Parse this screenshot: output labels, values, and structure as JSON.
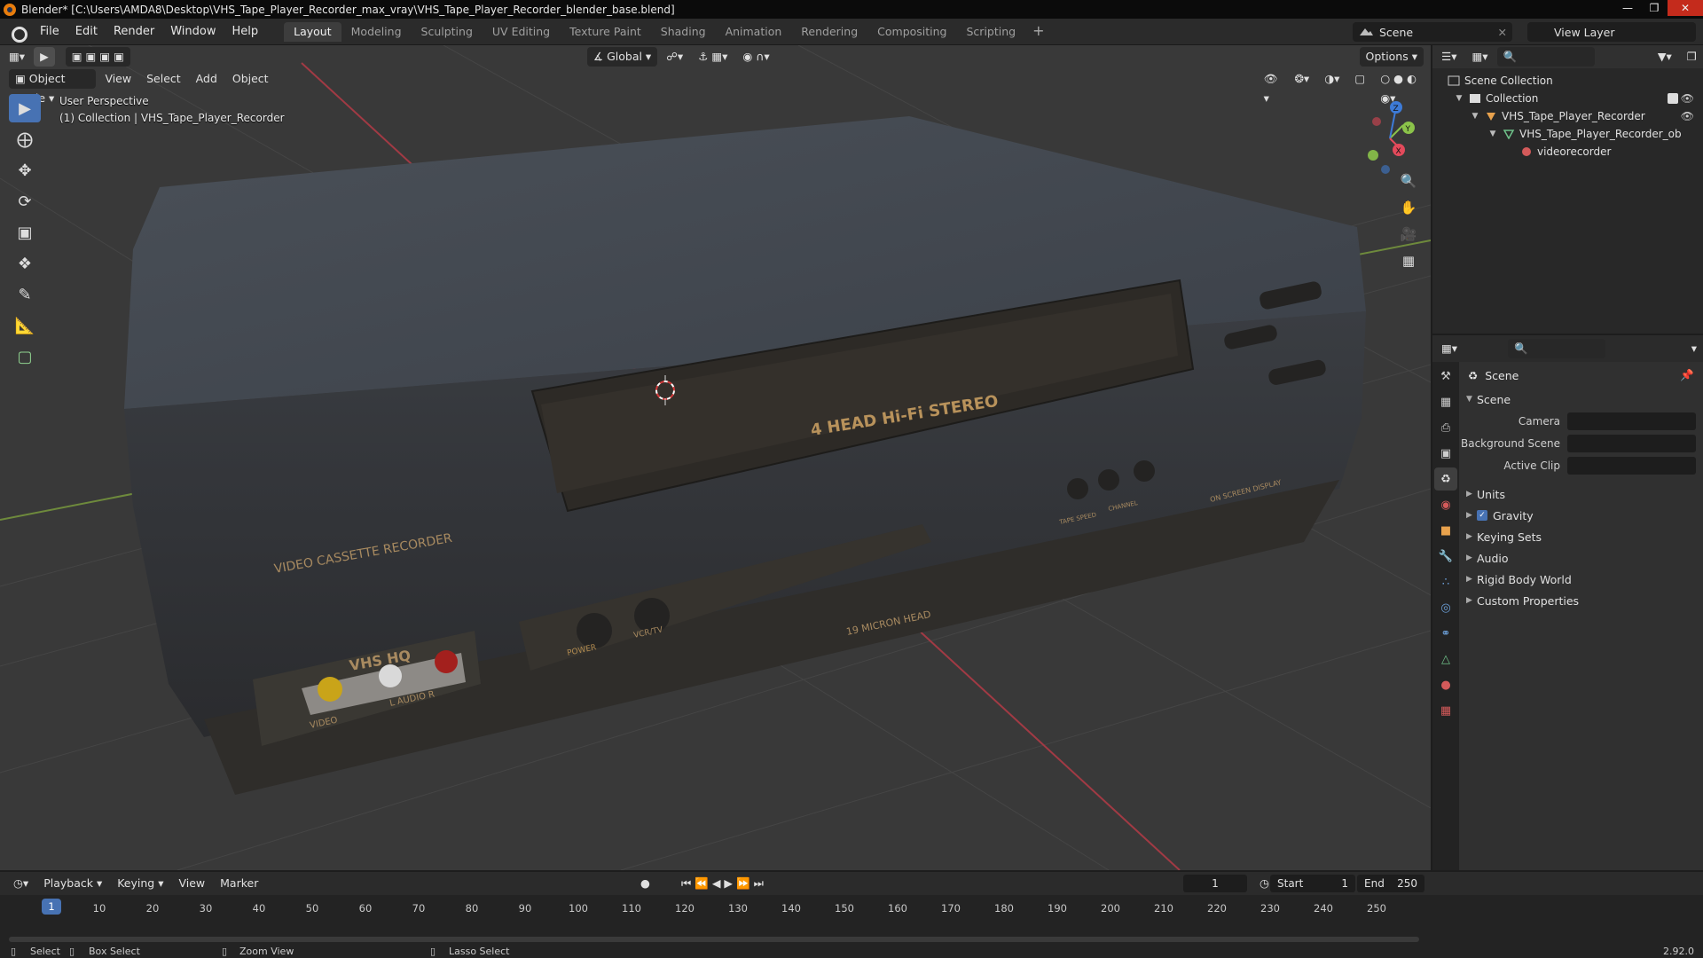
{
  "window": {
    "title": "Blender* [C:\\Users\\AMDA8\\Desktop\\VHS_Tape_Player_Recorder_max_vray\\VHS_Tape_Player_Recorder_blender_base.blend]"
  },
  "topbar": {
    "menus": [
      "File",
      "Edit",
      "Render",
      "Window",
      "Help"
    ],
    "workspaces": [
      "Layout",
      "Modeling",
      "Sculpting",
      "UV Editing",
      "Texture Paint",
      "Shading",
      "Animation",
      "Rendering",
      "Compositing",
      "Scripting"
    ],
    "active_workspace": "Layout",
    "scene_name": "Scene",
    "view_layer": "View Layer"
  },
  "viewport": {
    "mode": "Object Mode",
    "menus": [
      "View",
      "Select",
      "Add",
      "Object"
    ],
    "orientation": "Global",
    "options_label": "Options",
    "overlay_line1": "User Perspective",
    "overlay_line2": "(1) Collection | VHS_Tape_Player_Recorder",
    "gizmo_axes": {
      "x": "X",
      "y": "Y",
      "z": "Z"
    },
    "model_text": {
      "head": "4 HEAD Hi-Fi STEREO",
      "vcr": "VIDEO CASSETTE RECORDER",
      "vhs": "VHS HQ",
      "micron": "19 MICRON HEAD",
      "power": "POWER",
      "vcrtv": "VCR/TV",
      "audio": "L  AUDIO  R",
      "video": "VIDEO",
      "tape_speed": "TAPE SPEED",
      "channel": "CHANNEL",
      "osd": "ON SCREEN DISPLAY"
    }
  },
  "outliner": {
    "rows": [
      {
        "label": "Scene Collection",
        "depth": 0
      },
      {
        "label": "Collection",
        "depth": 1
      },
      {
        "label": "VHS_Tape_Player_Recorder",
        "depth": 2
      },
      {
        "label": "VHS_Tape_Player_Recorder_ob",
        "depth": 3
      },
      {
        "label": "videorecorder",
        "depth": 4
      }
    ]
  },
  "properties": {
    "breadcrumb": "Scene",
    "section": "Scene",
    "fields": [
      {
        "label": "Camera"
      },
      {
        "label": "Background Scene"
      },
      {
        "label": "Active Clip"
      }
    ],
    "panels": [
      "Units",
      "Gravity",
      "Keying Sets",
      "Audio",
      "Rigid Body World",
      "Custom Properties"
    ]
  },
  "timeline": {
    "menus": [
      "Playback",
      "Keying",
      "View",
      "Marker"
    ],
    "current_frame": "1",
    "start_label": "Start",
    "start": "1",
    "end_label": "End",
    "end": "250",
    "ticks": [
      "10",
      "20",
      "30",
      "40",
      "50",
      "60",
      "70",
      "80",
      "90",
      "100",
      "110",
      "120",
      "130",
      "140",
      "150",
      "160",
      "170",
      "180",
      "190",
      "200",
      "210",
      "220",
      "230",
      "240",
      "250"
    ],
    "playhead_label": "1"
  },
  "statusbar": {
    "items": [
      "Select",
      "Box Select",
      "Zoom View",
      "Lasso Select"
    ],
    "version": "2.92.0"
  },
  "colors": {
    "accent": "#4772b3",
    "axis_x": "#e34a5b",
    "axis_y": "#8bc34a",
    "axis_z": "#3d7bd8"
  }
}
